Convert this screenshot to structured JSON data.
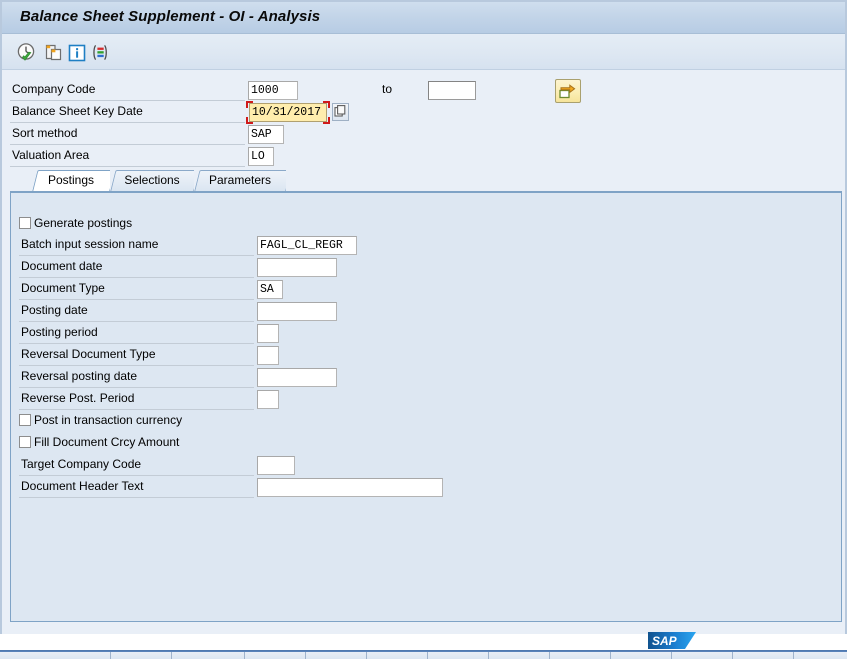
{
  "window": {
    "title": "Balance Sheet Supplement - OI - Analysis"
  },
  "toolbar": {
    "buttons": [
      {
        "name": "execute-icon",
        "tooltip": "Execute"
      },
      {
        "name": "get-variant-icon",
        "tooltip": "Get Variant"
      },
      {
        "name": "info-icon",
        "tooltip": "Information"
      },
      {
        "name": "display-variant-icon",
        "tooltip": "Display Variant"
      }
    ]
  },
  "selection": {
    "to_label": "to",
    "multiselect_button_label": "",
    "fields": [
      {
        "label": "Company Code",
        "value": "1000"
      },
      {
        "label": "Balance Sheet Key Date",
        "value": "10/31/2017"
      },
      {
        "label": "Sort method",
        "value": "SAP"
      },
      {
        "label": "Valuation Area",
        "value": "LO"
      }
    ],
    "company_code_to_value": ""
  },
  "tabs": [
    {
      "label": "Postings",
      "active": true
    },
    {
      "label": "Selections",
      "active": false
    },
    {
      "label": "Parameters",
      "active": false
    }
  ],
  "postings": {
    "generate_postings": {
      "label": "Generate postings",
      "checked": false
    },
    "batch_input_session_name": {
      "label": "Batch input session name",
      "value": "FAGL_CL_REGR"
    },
    "document_date": {
      "label": "Document date",
      "value": ""
    },
    "document_type": {
      "label": "Document Type",
      "value": "SA"
    },
    "posting_date": {
      "label": "Posting date",
      "value": ""
    },
    "posting_period": {
      "label": "Posting period",
      "value": ""
    },
    "reversal_document_type": {
      "label": "Reversal Document Type",
      "value": ""
    },
    "reversal_posting_date": {
      "label": "Reversal posting date",
      "value": ""
    },
    "reverse_post_period": {
      "label": "Reverse Post. Period",
      "value": ""
    },
    "post_in_transaction_currency": {
      "label": "Post in transaction currency",
      "checked": false
    },
    "fill_document_crcy_amount": {
      "label": "Fill Document Crcy Amount",
      "checked": false
    },
    "target_company_code": {
      "label": "Target Company Code",
      "value": ""
    },
    "document_header_text": {
      "label": "Document Header Text",
      "value": ""
    }
  },
  "branding": {
    "logo_text": "SAP"
  },
  "colors": {
    "title_bar": "#c2d4e8",
    "screen_bg": "#e9eff7",
    "tab_body_bg": "#dde7f2",
    "tab_border": "#7fa3c6",
    "focus_field_bg": "#ffedad",
    "focus_outline": "#d01a1a",
    "sap_blue": "#1b74bd",
    "status_bar": "#4a74ab"
  }
}
